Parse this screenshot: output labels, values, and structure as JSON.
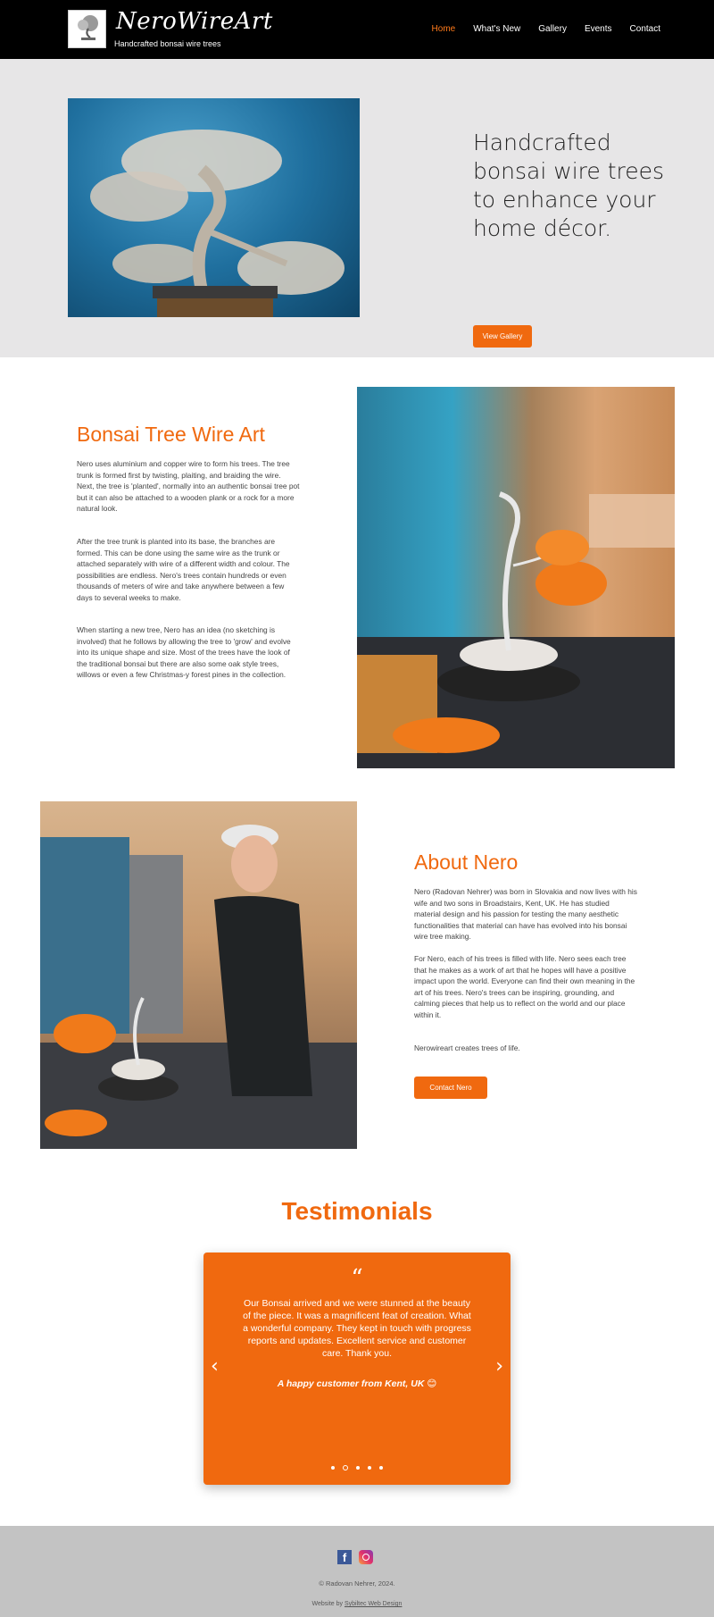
{
  "header": {
    "brand": "NeroWireArt",
    "tagline": "Handcrafted bonsai wire trees",
    "nav": [
      {
        "label": "Home",
        "active": true
      },
      {
        "label": "What's New"
      },
      {
        "label": "Gallery"
      },
      {
        "label": "Events"
      },
      {
        "label": "Contact"
      }
    ]
  },
  "hero": {
    "heading": "Handcrafted bonsai wire trees to enhance your home décor.",
    "button": "View Gallery"
  },
  "bonsai": {
    "title": "Bonsai Tree Wire Art",
    "paragraphs": [
      "Nero uses aluminium and copper wire to form his trees. The tree trunk is formed first by twisting, plaiting, and braiding the wire. Next, the tree is 'planted', normally into an authentic bonsai tree pot but it can also be attached to a wooden plank or a rock for a more natural look.",
      "After the tree trunk is planted into its base, the branches are formed. This can be done using the same wire as the trunk or attached separately with wire of a different width and colour. The possibilities are endless. Nero's trees contain hundreds or even thousands of meters of wire and take anywhere between a few days to several weeks to make.",
      "When starting a new tree, Nero has an idea (no sketching is involved) that he follows by allowing the tree to 'grow' and evolve into its unique shape and size. Most of the trees have the look of the traditional bonsai but there are also some oak style trees, willows or even a few Christmas-y forest pines in the collection."
    ]
  },
  "about": {
    "title": "About Nero",
    "paragraphs": [
      "Nero (Radovan Nehrer) was born in Slovakia and now lives with his wife and two sons in Broadstairs, Kent, UK. He has studied material design and his passion for testing the many aesthetic functionalities that material can have has evolved into his bonsai wire tree making.",
      "For Nero, each of his trees is filled with life. Nero sees each tree that he makes as a work of art that he hopes will have a positive impact upon the world. Everyone can find their own meaning in the art of his trees. Nero's trees can be inspiring, grounding, and calming pieces that help us to reflect on the world and our place within it.",
      "Nerowireart creates trees of life."
    ],
    "button": "Contact Nero"
  },
  "testimonials": {
    "title": "Testimonials",
    "quote_mark": "“",
    "quote": "Our Bonsai arrived and we were stunned at the beauty of the piece. It was a magnificent feat of creation. What a wonderful company. They kept in touch with progress reports and updates. Excellent service and customer care. Thank you.",
    "author": "A happy customer from Kent, UK 😊",
    "prev": "‹",
    "next": "›",
    "dot_count": 5,
    "active_dot": 2
  },
  "footer": {
    "copyright": "© Radovan Nehrer, 2024.",
    "credit_prefix": "Website by ",
    "credit_link": "Sybiltec Web Design",
    "social": [
      "facebook-icon",
      "instagram-icon"
    ]
  },
  "colors": {
    "accent": "#f0690f",
    "header_bg": "#000000",
    "hero_bg": "#e7e6e7",
    "footer_bg": "#c3c3c3"
  }
}
